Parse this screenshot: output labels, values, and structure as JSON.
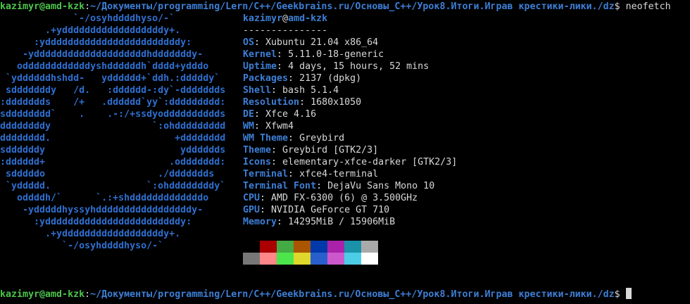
{
  "prompt": {
    "user_host": "kazimyr@amd-kzk",
    "colon": ":",
    "path": "~/Документы/programming/Lern/C++/Geekbrains.ru/Основы_C++/Урок8.Итоги.Играв крестики-лики./dz",
    "symbol": "$",
    "command": " neofetch"
  },
  "ascii_logo": "             `-/osyhddddhyso/-`\n        .+yddddddddddddddddddy+.\n      :yddddddddddddddddddddddddy:\n    -yddddddddddddddddddddhdddddddy-\n   oddddddddddddyshddddddh`dddd+ydddo\n `yddddddhshdd-   ydddddd+`ddh.:dddddy`\n sdddddddy   /d.   :dddddd-:dy`-ddddddds\n:ddddddds    /+   .dddddd`yy`:ddddddddd:\nsdddddddd`    .    .-:/+ssdyodddddddddds\nddddddddy                  `:ohddddddddd\ndddddddd.                      +dddddddd\nsddddddy                        ydddddds\n:dddddd+                      .oddddddd:\n sdddddo                    ./ddddddds\n `yddddd.                 `:ohddddddddy`\n   oddddh/`      `.:+shdddddddddddddo\n    -ydddddhyssyhdddddddddddddddddy-\n      :yddddddddddddddddddddddddy:\n        .+yddddddddddddddddddy+.\n           `-/osyhddddhyso/-`",
  "info": {
    "title_user": "kazimyr",
    "title_at": "@",
    "title_host": "amd-kzk",
    "separator": "---------------",
    "rows": [
      {
        "key": "OS",
        "value": "Xubuntu 21.04 x86_64"
      },
      {
        "key": "Kernel",
        "value": "5.11.0-18-generic"
      },
      {
        "key": "Uptime",
        "value": "4 days, 15 hours, 52 mins"
      },
      {
        "key": "Packages",
        "value": "2137 (dpkg)"
      },
      {
        "key": "Shell",
        "value": "bash 5.1.4"
      },
      {
        "key": "Resolution",
        "value": "1680x1050"
      },
      {
        "key": "DE",
        "value": "Xfce 4.16"
      },
      {
        "key": "WM",
        "value": "Xfwm4"
      },
      {
        "key": "WM Theme",
        "value": "Greybird"
      },
      {
        "key": "Theme",
        "value": "Greybird [GTK2/3]"
      },
      {
        "key": "Icons",
        "value": "elementary-xfce-darker [GTK2/3]"
      },
      {
        "key": "Terminal",
        "value": "xfce4-terminal"
      },
      {
        "key": "Terminal Font",
        "value": "DejaVu Sans Mono 10"
      },
      {
        "key": "CPU",
        "value": "AMD FX-6300 (6) @ 3.500GHz"
      },
      {
        "key": "GPU",
        "value": "NVIDIA GeForce GT 710"
      },
      {
        "key": "Memory",
        "value": "14295MiB / 15906MiB"
      }
    ]
  },
  "palette": {
    "normal": [
      "#000000",
      "#aa0000",
      "#44aa44",
      "#aa5500",
      "#0039aa",
      "#aa22aa",
      "#1a92aa",
      "#aaaaaa"
    ],
    "bright": [
      "#777777",
      "#ff8787",
      "#4ce64c",
      "#ded82c",
      "#295fcc",
      "#cc58cc",
      "#4ccce6",
      "#ffffff"
    ]
  },
  "colors": {
    "background": "#000000",
    "user_green": "#4cc64c",
    "path_blue": "#3d7fd6",
    "logo_blue": "#2f6fd0",
    "text": "#d8d8d8"
  }
}
